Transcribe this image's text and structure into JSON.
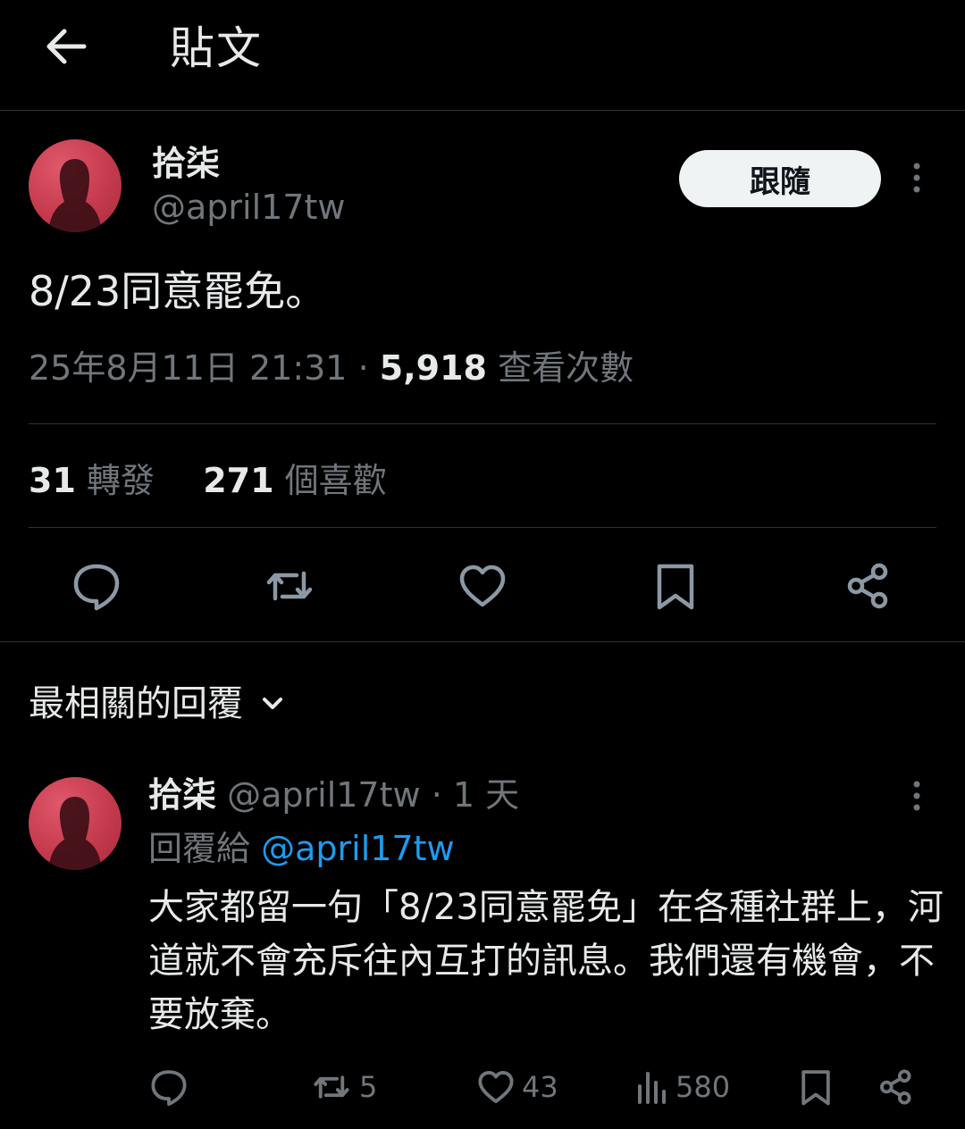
{
  "header": {
    "title": "貼文",
    "back_icon": "arrow-left-icon"
  },
  "tweet": {
    "author_name": "拾柒",
    "author_handle": "@april17tw",
    "follow_label": "跟隨",
    "text": "8/23同意罷免。",
    "timestamp": "25年8月11日 21:31",
    "separator": "·",
    "views_count": "5,918",
    "views_label": "查看次數",
    "retweets_count": "31",
    "retweets_label": "轉發",
    "likes_count": "271",
    "likes_label": "個喜歡",
    "actions": [
      "reply-icon",
      "retweet-icon",
      "like-icon",
      "bookmark-icon",
      "share-icon"
    ]
  },
  "replies_section": {
    "title": "最相關的回覆",
    "sort_icon": "chevron-down-icon"
  },
  "reply": {
    "author_name": "拾柒",
    "author_handle": "@april17tw",
    "separator": "·",
    "time": "1 天",
    "replying_to_label": "回覆給",
    "replying_to_handle": "@april17tw",
    "text": "大家都留一句「8/23同意罷免」在各種社群上，河道就不會充斥往內互打的訊息。我們還有機會，不要放棄。",
    "retweets": "5",
    "likes": "43",
    "views": "580"
  },
  "colors": {
    "background": "#000000",
    "text": "#e7e9ea",
    "muted": "#71767b",
    "link": "#1d9bf0",
    "divider": "#2f3336",
    "avatar": "#c53a4d"
  }
}
